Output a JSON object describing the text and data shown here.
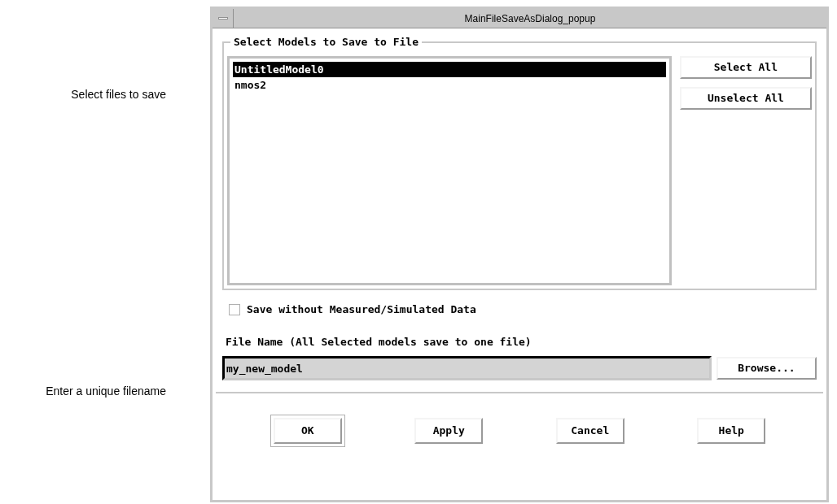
{
  "annotations": [
    "Select files to save",
    "Enter a unique filename"
  ],
  "window": {
    "title": "MainFileSaveAsDialog_popup"
  },
  "models_group": {
    "title": "Select Models to Save to File",
    "models": [
      {
        "name": "UntitledModel0",
        "selected": true
      },
      {
        "name": "nmos2",
        "selected": false
      }
    ],
    "buttons": [
      "Select All",
      "Unselect All"
    ]
  },
  "save_without_data": {
    "label": "Save without Measured/Simulated Data",
    "checked": false
  },
  "file_name": {
    "label": "File Name (All Selected models save to one file)",
    "value": "my_new_model",
    "browse": "Browse..."
  },
  "buttons": [
    {
      "label": "OK",
      "default": true
    },
    {
      "label": "Apply",
      "default": false
    },
    {
      "label": "Cancel",
      "default": false
    },
    {
      "label": "Help",
      "default": false
    }
  ]
}
